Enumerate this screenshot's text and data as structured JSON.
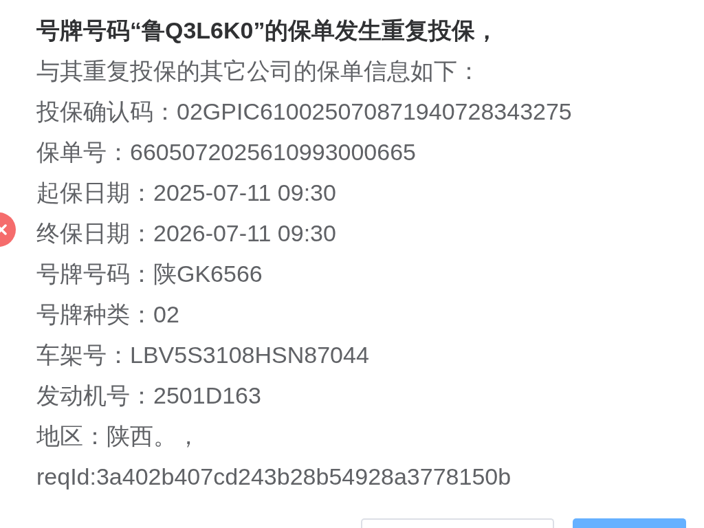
{
  "status_icon": {
    "kind": "error"
  },
  "title": "号牌号码“鲁Q3L6K0”的保单发生重复投保，",
  "intro": "与其重复投保的其它公司的保单信息如下：",
  "fields": [
    {
      "label": "投保确认码：",
      "value": "02GPIC610025070871940728343275"
    },
    {
      "label": "保单号：",
      "value": "6605072025610993000665"
    },
    {
      "label": "起保日期：",
      "value": "2025-07-11 09:30"
    },
    {
      "label": "终保日期：",
      "value": "2026-07-11 09:30"
    },
    {
      "label": "号牌号码：",
      "value": "陕GK6566"
    },
    {
      "label": "号牌种类：",
      "value": "02"
    },
    {
      "label": "车架号：",
      "value": "LBV5S3108HSN87044"
    },
    {
      "label": "发动机号：",
      "value": "2501D163"
    },
    {
      "label": "地区：",
      "value": "陕西。，"
    }
  ],
  "request_id": "reqId:3a402b407cd243b28b54928a3778150b",
  "buttons": [
    {
      "kind": "default"
    },
    {
      "kind": "primary"
    }
  ]
}
